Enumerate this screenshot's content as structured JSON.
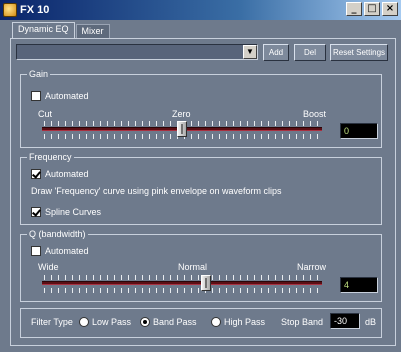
{
  "window": {
    "title": "FX 10",
    "controls": [
      "_",
      "□",
      "×"
    ]
  },
  "tabs": [
    {
      "label": "Dynamic EQ",
      "active": true
    },
    {
      "label": "Mixer",
      "active": false
    }
  ],
  "toolbar": {
    "preset_value": "",
    "add_label": "Add",
    "del_label": "Del",
    "reset_label": "Reset Settings"
  },
  "gain": {
    "title": "Gain",
    "automated_label": "Automated",
    "automated": false,
    "cut_label": "Cut",
    "zero_label": "Zero",
    "boost_label": "Boost",
    "value": "0",
    "slider_fraction": 0.5
  },
  "frequency": {
    "title": "Frequency",
    "automated_label": "Automated",
    "automated": true,
    "description": "Draw 'Frequency' curve using pink envelope on waveform clips",
    "spline_label": "Spline Curves",
    "spline": true
  },
  "q": {
    "title": "Q (bandwidth)",
    "automated_label": "Automated",
    "automated": false,
    "wide_label": "Wide",
    "normal_label": "Normal",
    "narrow_label": "Narrow",
    "value": "4",
    "slider_fraction": 0.59
  },
  "filter": {
    "type_label": "Filter Type",
    "options": [
      {
        "label": "Low Pass",
        "selected": false
      },
      {
        "label": "Band Pass",
        "selected": true
      },
      {
        "label": "High Pass",
        "selected": false
      }
    ],
    "stop_band_label": "Stop Band",
    "stop_band_value": "-30",
    "unit": "dB"
  },
  "colors": {
    "window_bg": "#6e7a8c",
    "title_bar": "#0a246a",
    "slider_track": "#5a0e14"
  }
}
